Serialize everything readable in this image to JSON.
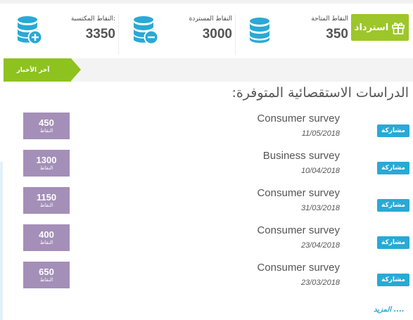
{
  "header": {
    "earned": {
      "label": "النقاط المكتسبة:",
      "value": "3350"
    },
    "redeemed": {
      "label": "النقاط المستردة",
      "value": "3000"
    },
    "available": {
      "label": "النقاط المتاحة",
      "value": "350"
    },
    "redeem_button": "استرداد"
  },
  "news_tab": "آخر الأخبار",
  "surveys_title": "الدراسات الاستقصائية المتوفرة:",
  "join_label": "مشاركة",
  "points_unit": "النقاط",
  "surveys": [
    {
      "name": "Consumer survey",
      "date": "11/05/2018",
      "points": "450"
    },
    {
      "name": "Business survey",
      "date": "10/04/2018",
      "points": "1300"
    },
    {
      "name": "Consumer survey",
      "date": "31/03/2018",
      "points": "1150"
    },
    {
      "name": "Consumer survey",
      "date": "23/04/2018",
      "points": "400"
    },
    {
      "name": "Consumer survey",
      "date": "23/03/2018",
      "points": "650"
    }
  ],
  "more_link": "المزيد ....",
  "colors": {
    "accent_green": "#8ec21f",
    "button_green": "#9dc62a",
    "join_blue": "#29a9d6",
    "points_purple": "#a48fb8",
    "db_icon_blue": "#29a9d6"
  },
  "icons": [
    "database-plus-icon",
    "database-minus-icon",
    "database-icon",
    "gift-icon"
  ]
}
